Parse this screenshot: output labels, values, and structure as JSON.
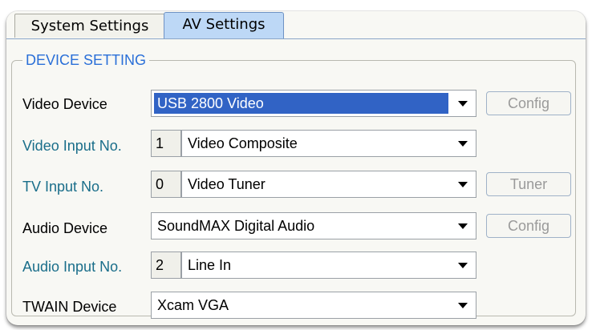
{
  "tabs": [
    {
      "label": "System Settings",
      "active": false
    },
    {
      "label": "AV Settings",
      "active": true
    }
  ],
  "group": {
    "title": "DEVICE SETTING"
  },
  "rows": {
    "video_device": {
      "label": "Video Device",
      "value": "USB 2800 Video",
      "button": "Config"
    },
    "video_input": {
      "label": "Video Input No.",
      "number": "1",
      "value": "Video Composite"
    },
    "tv_input": {
      "label": "TV Input No.",
      "number": "0",
      "value": "Video Tuner",
      "button": "Tuner"
    },
    "audio_device": {
      "label": "Audio Device",
      "value": "SoundMAX Digital Audio",
      "button": "Config"
    },
    "audio_input": {
      "label": "Audio Input No.",
      "number": "2",
      "value": "Line In"
    },
    "twain_device": {
      "label": "TWAIN Device",
      "value": "Xcam VGA"
    }
  },
  "colors": {
    "accent_label": "#1a6e8a",
    "group_title": "#2a6fd8",
    "selection": "#3163c5",
    "active_tab": "#bdd8f6"
  },
  "icons": {
    "dropdown": "chevron-down-icon"
  }
}
